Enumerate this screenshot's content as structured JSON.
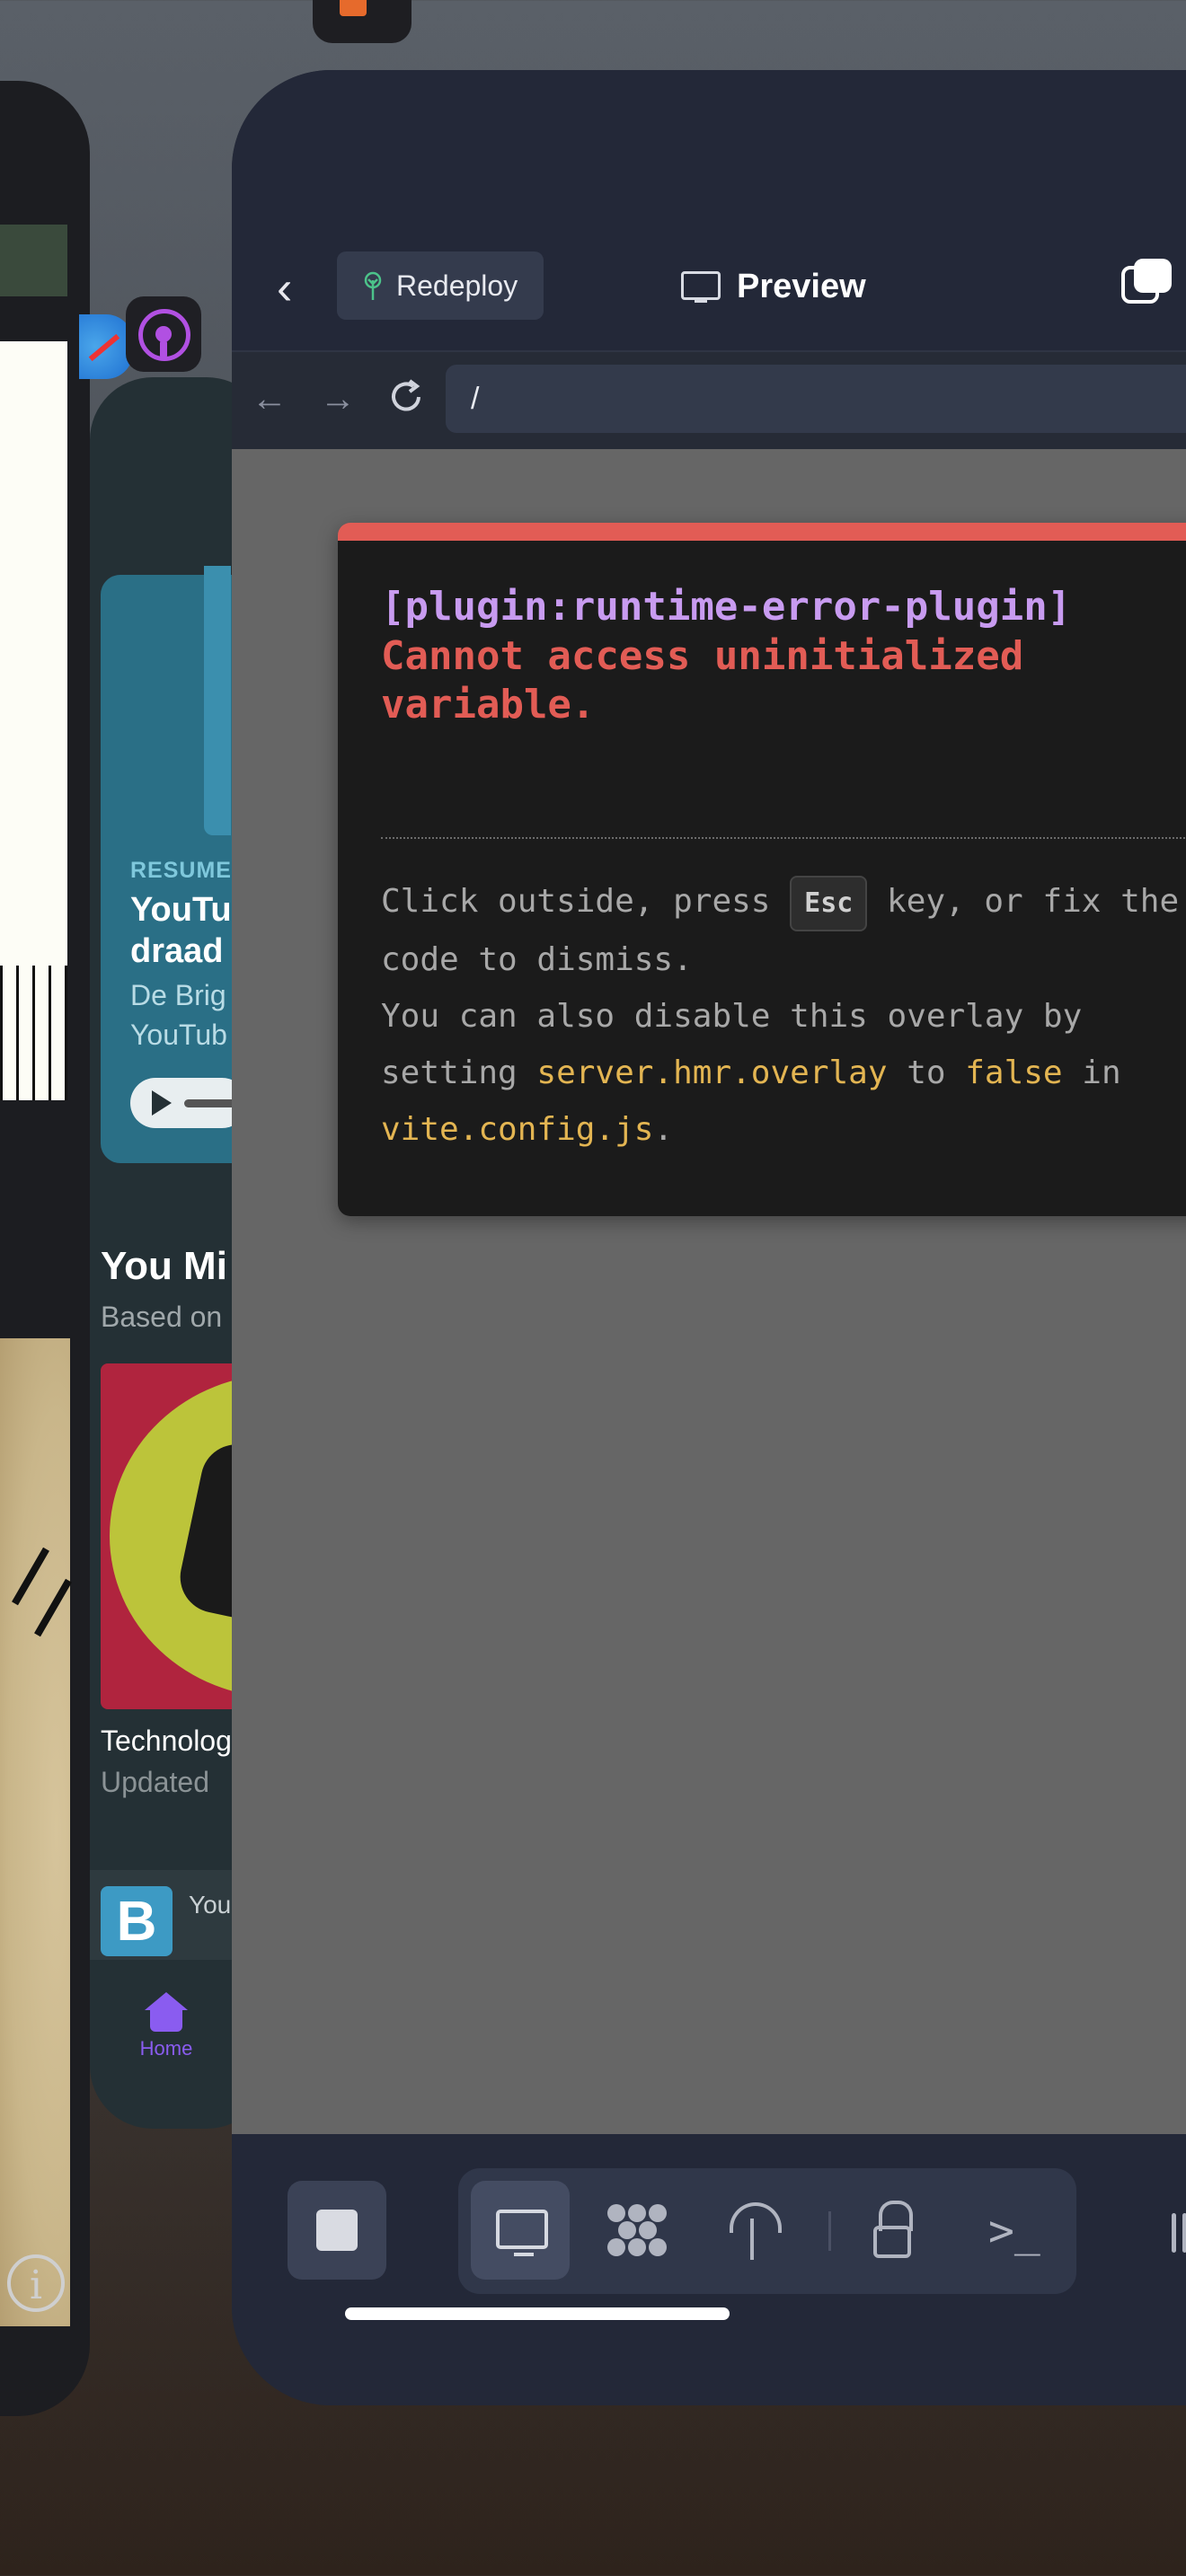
{
  "header": {
    "redeploy_label": "Redeploy",
    "title": "Preview"
  },
  "nav": {
    "url": "/"
  },
  "error_overlay": {
    "plugin": "[plugin:runtime-error-plugin]",
    "message": "Cannot access uninitialized variable.",
    "help_pre": "Click outside, press ",
    "help_key": "Esc",
    "help_mid": " key, or fix the code to dismiss.",
    "help_line2_pre": "You can also disable this overlay by setting ",
    "help_code1": "server.hmr.overlay",
    "help_to": " to ",
    "help_code2": "false",
    "help_in": " in ",
    "help_code3": "vite.config.js",
    "help_end": "."
  },
  "podcasts_card": {
    "resume_label": "RESUME",
    "episode_title": "YouTu draad",
    "episode_sub": "De Brig YouTub",
    "section_title": "You Mi",
    "section_sub": "Based on",
    "show_name": "Technolog",
    "show_updated": "Updated",
    "mini_player_initial": "B",
    "mini_player_text": "You",
    "home_tab": "Home"
  },
  "colors": {
    "error_red": "#e25c55",
    "plugin_purple": "#c89bf0",
    "code_yellow": "#e3b552",
    "accent_purple": "#8a5cf0"
  }
}
